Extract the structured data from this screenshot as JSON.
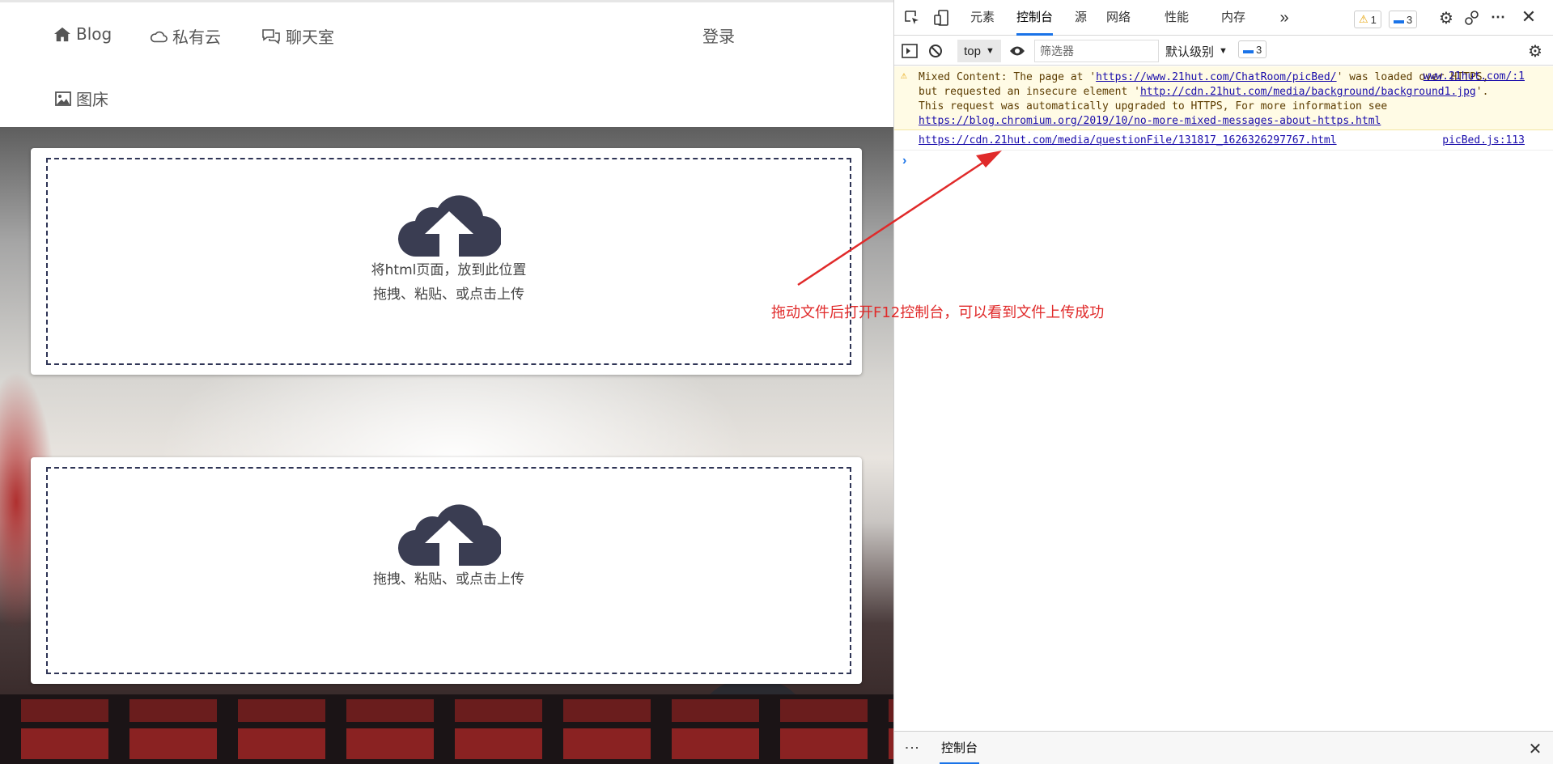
{
  "page": {
    "nav": {
      "blog": "Blog",
      "cloud": "私有云",
      "chat": "聊天室",
      "login": "登录",
      "picbed": "图床"
    },
    "upload_html": {
      "line1": "将html页面，放到此位置",
      "line2": "拖拽、粘贴、或点击上传"
    },
    "upload_file": {
      "line1": "拖拽、粘贴、或点击上传"
    },
    "annotation": "拖动文件后打开F12控制台，可以看到文件上传成功",
    "colors": {
      "annotation": "#e02a2a",
      "cloud": "#3a3d52",
      "dashed_border": "#2f3556"
    }
  },
  "devtools": {
    "tabs": [
      "元素",
      "控制台",
      "源",
      "网络",
      "性能",
      "内存"
    ],
    "active_tab": "控制台",
    "warning_count": "1",
    "message_count": "3",
    "toolbar": {
      "context": "top",
      "filter_placeholder": "筛选器",
      "levels": "默认级别",
      "issues_count": "3"
    },
    "console": {
      "warning": {
        "prefix": "Mixed Content: The page at '",
        "url1": "https://www.21hut.com/ChatRoom/picBed/",
        "mid1": "' was loaded over HTTPS, but requested an insecure element '",
        "url2": "http://cdn.21hut.com/media/background/background1.jpg",
        "mid2": "'. This request was automatically upgraded to HTTPS, For more information see ",
        "url3": "https://blog.chromium.org/2019/10/no-more-mixed-messages-about-https.html",
        "source": "www.21hut.com/:1"
      },
      "log": {
        "url": "https://cdn.21hut.com/media/questionFile/131817_1626326297767.html",
        "source": "picBed.js:113"
      },
      "prompt": "›"
    },
    "drawer": {
      "tab": "控制台",
      "more": "⋮"
    }
  }
}
